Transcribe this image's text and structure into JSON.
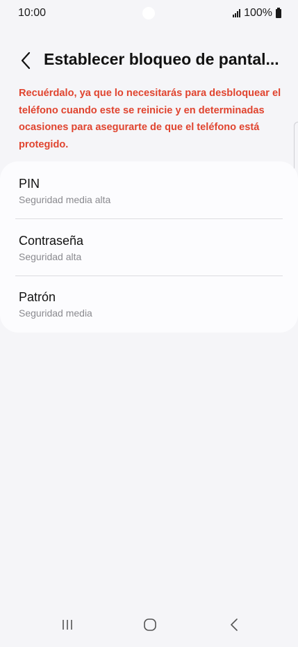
{
  "status_bar": {
    "time": "10:00",
    "battery": "100%"
  },
  "header": {
    "title": "Establecer bloqueo de pantal..."
  },
  "warning_text": "Recuérdalo, ya que lo necesitarás para desbloquear el teléfono cuando este se reinicie y en determinadas ocasiones para asegurarte de que el teléfono está protegido.",
  "options": [
    {
      "label": "PIN",
      "sub": "Seguridad media alta"
    },
    {
      "label": "Contraseña",
      "sub": "Seguridad alta"
    },
    {
      "label": "Patrón",
      "sub": "Seguridad media"
    }
  ],
  "colors": {
    "background": "#f5f5f8",
    "card": "#fcfcfe",
    "warning": "#e0442f"
  },
  "nav": {
    "recents_icon": "recent-apps-icon",
    "home_icon": "home-icon",
    "back_icon": "back-icon"
  }
}
